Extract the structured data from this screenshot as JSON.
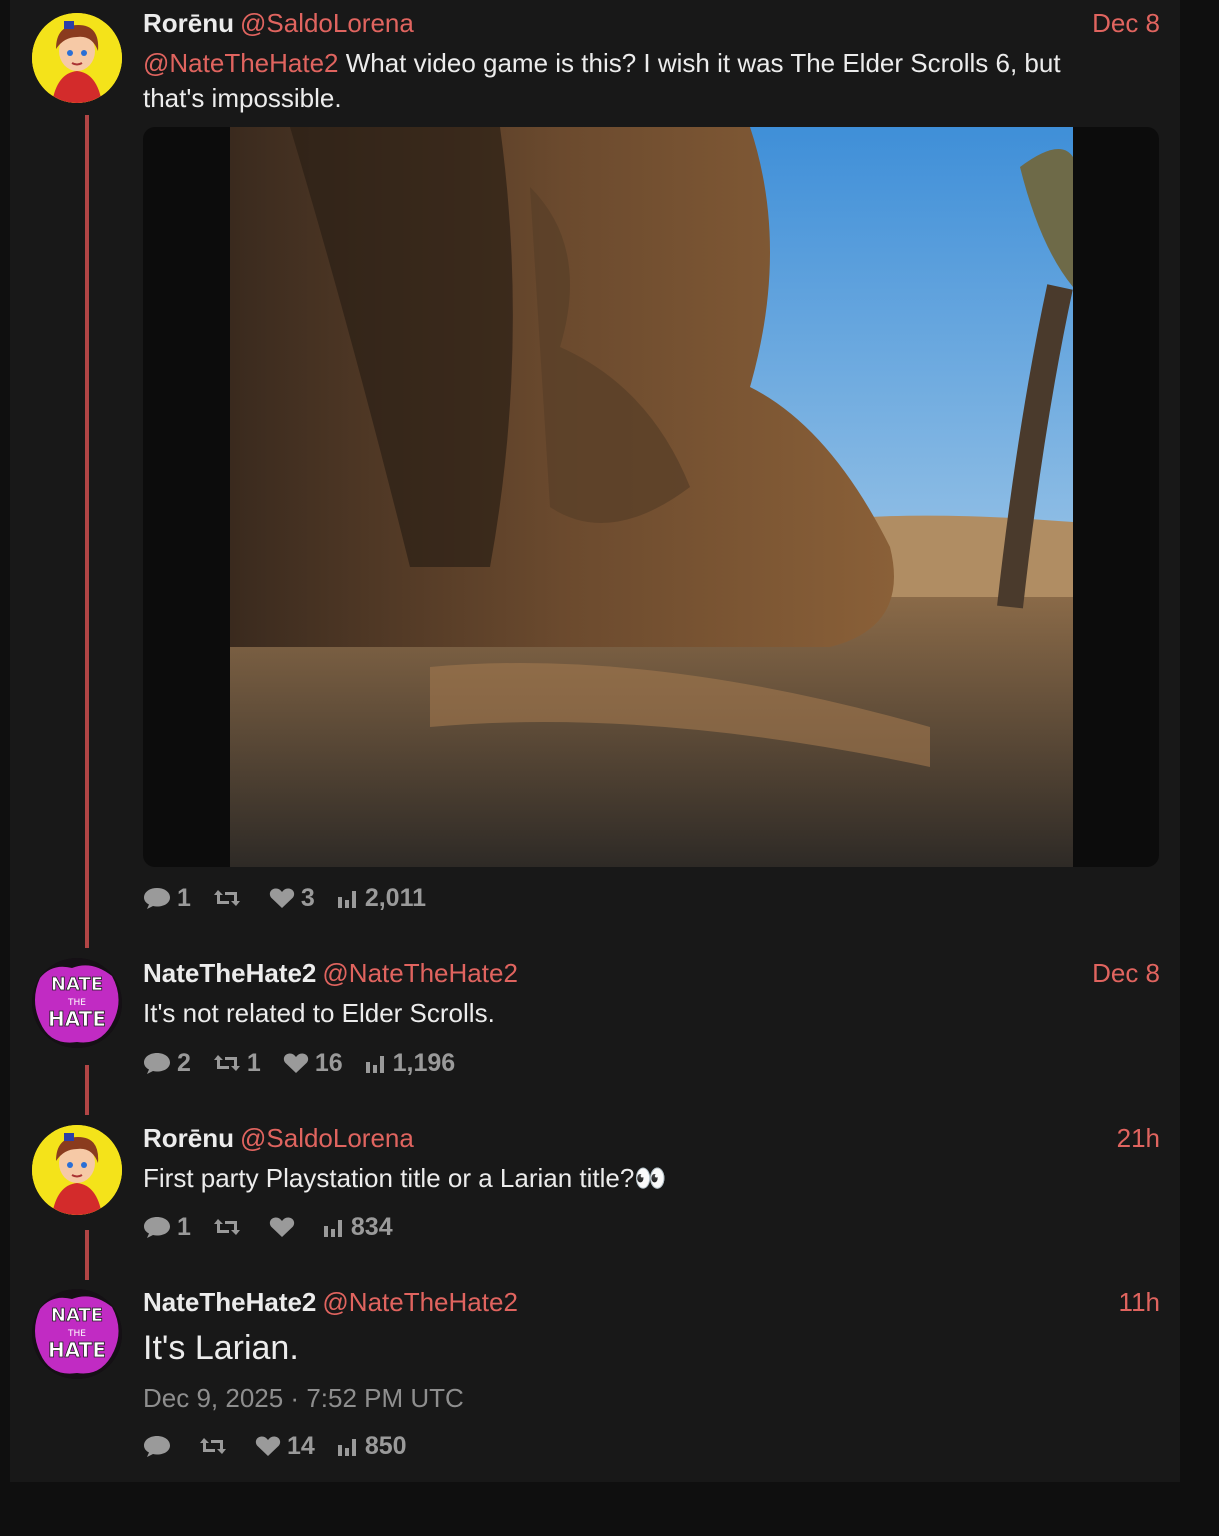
{
  "colors": {
    "accent": "#e0645f",
    "thread_line": "#b14545",
    "panel": "#181818",
    "background": "#0f0f0f"
  },
  "tweets": [
    {
      "name": "Rorēnu",
      "handle": "@SaldoLorena",
      "date": "Dec 8",
      "mention": "@NateTheHate2",
      "text": " What video game is this? I wish it was The Elder Scrolls 6, but that's impossible.",
      "has_image": true,
      "stats": {
        "replies": "1",
        "retweets": "",
        "likes": "3",
        "views": "2,011"
      }
    },
    {
      "name": "NateTheHate2",
      "handle": "@NateTheHate2",
      "date": "Dec 8",
      "text": "It's not related to Elder Scrolls.",
      "stats": {
        "replies": "2",
        "retweets": "1",
        "likes": "16",
        "views": "1,196"
      }
    },
    {
      "name": "Rorēnu",
      "handle": "@SaldoLorena",
      "date": "21h",
      "text": "First party Playstation title or a Larian title?👀",
      "stats": {
        "replies": "1",
        "retweets": "",
        "likes": "",
        "views": "834"
      }
    },
    {
      "name": "NateTheHate2",
      "handle": "@NateTheHate2",
      "date": "11h",
      "text": "It's Larian.",
      "full_date": "Dec 9, 2025 · 7:52 PM UTC",
      "stats": {
        "replies": "",
        "retweets": "",
        "likes": "14",
        "views": "850"
      }
    }
  ],
  "avatar_text": {
    "nate_line1": "NATE",
    "nate_line2": "THE",
    "nate_line3": "HATE"
  }
}
